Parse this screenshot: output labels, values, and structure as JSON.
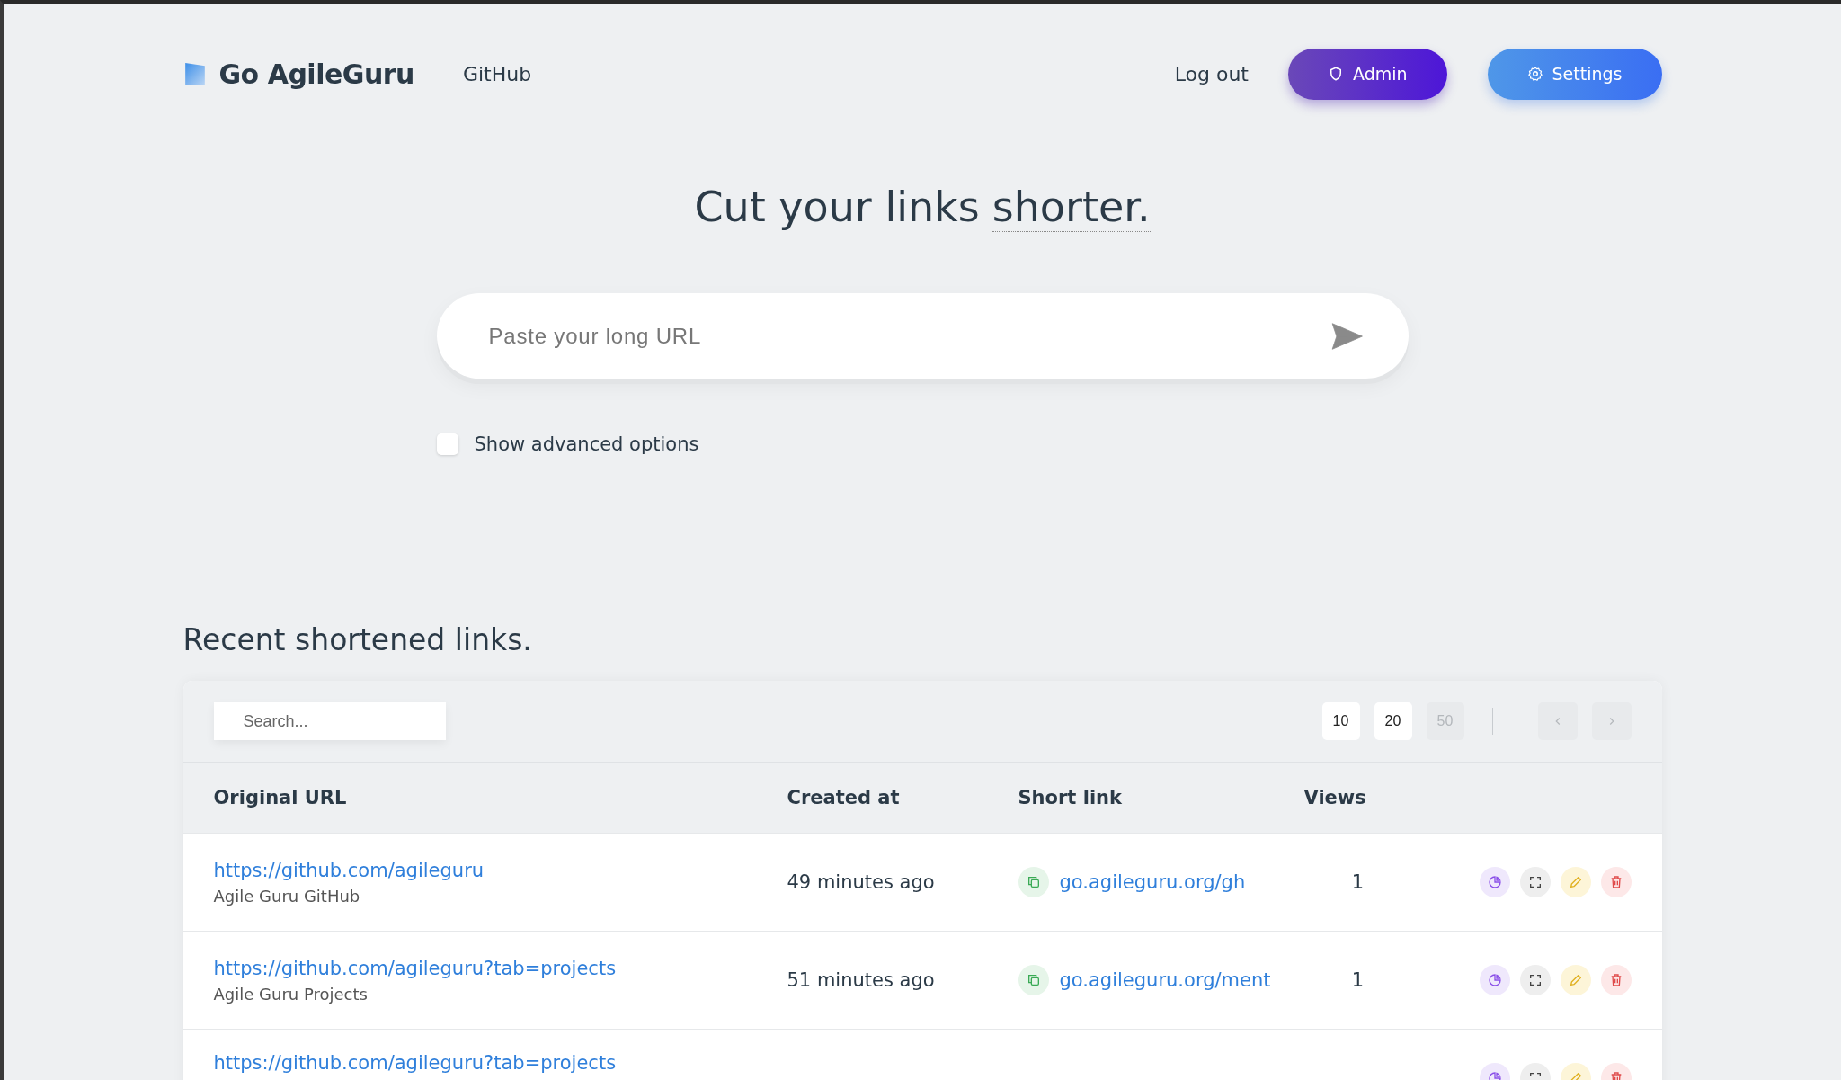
{
  "nav": {
    "brand": "Go AgileGuru",
    "links": [
      "GitHub"
    ],
    "logout": "Log out",
    "buttons": [
      {
        "kind": "admin",
        "label": "Admin"
      },
      {
        "kind": "settings",
        "label": "Settings"
      }
    ]
  },
  "hero": {
    "title": "Cut your links",
    "emphasis": "shorter.",
    "placeholder": "Paste your long URL",
    "advanced": {
      "label": "Show advanced options",
      "checked": false
    }
  },
  "recent": {
    "heading": "Recent shortened links.",
    "search_placeholder": "Search...",
    "page_sizes": [
      {
        "label": "10",
        "disabled": false
      },
      {
        "label": "20",
        "disabled": false
      },
      {
        "label": "50",
        "disabled": true
      }
    ],
    "pager": [
      {
        "kind": "prev",
        "disabled": true
      },
      {
        "kind": "next",
        "disabled": true
      }
    ],
    "columns": [
      "Original URL",
      "Created at",
      "Short link",
      "Views"
    ],
    "rows": [
      {
        "url": "https://github.com/agileguru",
        "title": "Agile Guru GitHub",
        "created": "49 minutes ago",
        "short": "go.agileguru.org/gh",
        "views": "1"
      },
      {
        "url": "https://github.com/agileguru?tab=projects",
        "title": "Agile Guru Projects",
        "created": "51 minutes ago",
        "short": "go.agileguru.org/ment",
        "views": "1"
      },
      {
        "url": "https://github.com/agileguru?tab=projects"
      }
    ]
  }
}
